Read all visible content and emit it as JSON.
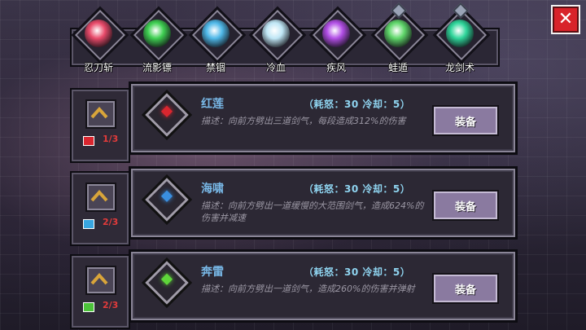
{
  "tabs": [
    {
      "label": "忍刀斩",
      "icon": "crimson-slash-icon",
      "color": "#e84a6a",
      "has_gem": false
    },
    {
      "label": "流影镖",
      "icon": "green-shuriken-icon",
      "color": "#3fcf52",
      "has_gem": false
    },
    {
      "label": "禁锢",
      "icon": "ice-orb-icon",
      "color": "#4fb8e8",
      "has_gem": false
    },
    {
      "label": "冷血",
      "icon": "ice-crystal-icon",
      "color": "#bfe6f5",
      "has_gem": false
    },
    {
      "label": "疾风",
      "icon": "violet-flame-icon",
      "color": "#b24fe6",
      "has_gem": false
    },
    {
      "label": "蛙遁",
      "icon": "frog-icon",
      "color": "#5fd66a",
      "has_gem": true
    },
    {
      "label": "龙剑术",
      "icon": "jade-sword-icon",
      "color": "#2fd59a",
      "has_gem": true
    }
  ],
  "skills": [
    {
      "name": "红莲",
      "stats": "（耗怒：30  冷却：5）",
      "description": "描述：向前方劈出三道剑气，每段造成312%的伤害",
      "equip_label": "装备",
      "level": "1/3",
      "gem_color": "#d9262f",
      "level_icon_color": "#d9262f"
    },
    {
      "name": "海啸",
      "stats": "（耗怒：30  冷却：5）",
      "description": "描述：向前方劈出一道缓慢的大范围剑气，造成624%的伤害并减速",
      "equip_label": "装备",
      "level": "2/3",
      "gem_color": "#3a8fe0",
      "level_icon_color": "#38a6e0"
    },
    {
      "name": "奔雷",
      "stats": "（耗怒：30  冷却：5）",
      "description": "描述：向前方劈出一道剑气，造成260%的伤害并弹射",
      "equip_label": "装备",
      "level": "2/3",
      "gem_color": "#5fd63a",
      "level_icon_color": "#4cc23a"
    }
  ],
  "close_label": "✕"
}
